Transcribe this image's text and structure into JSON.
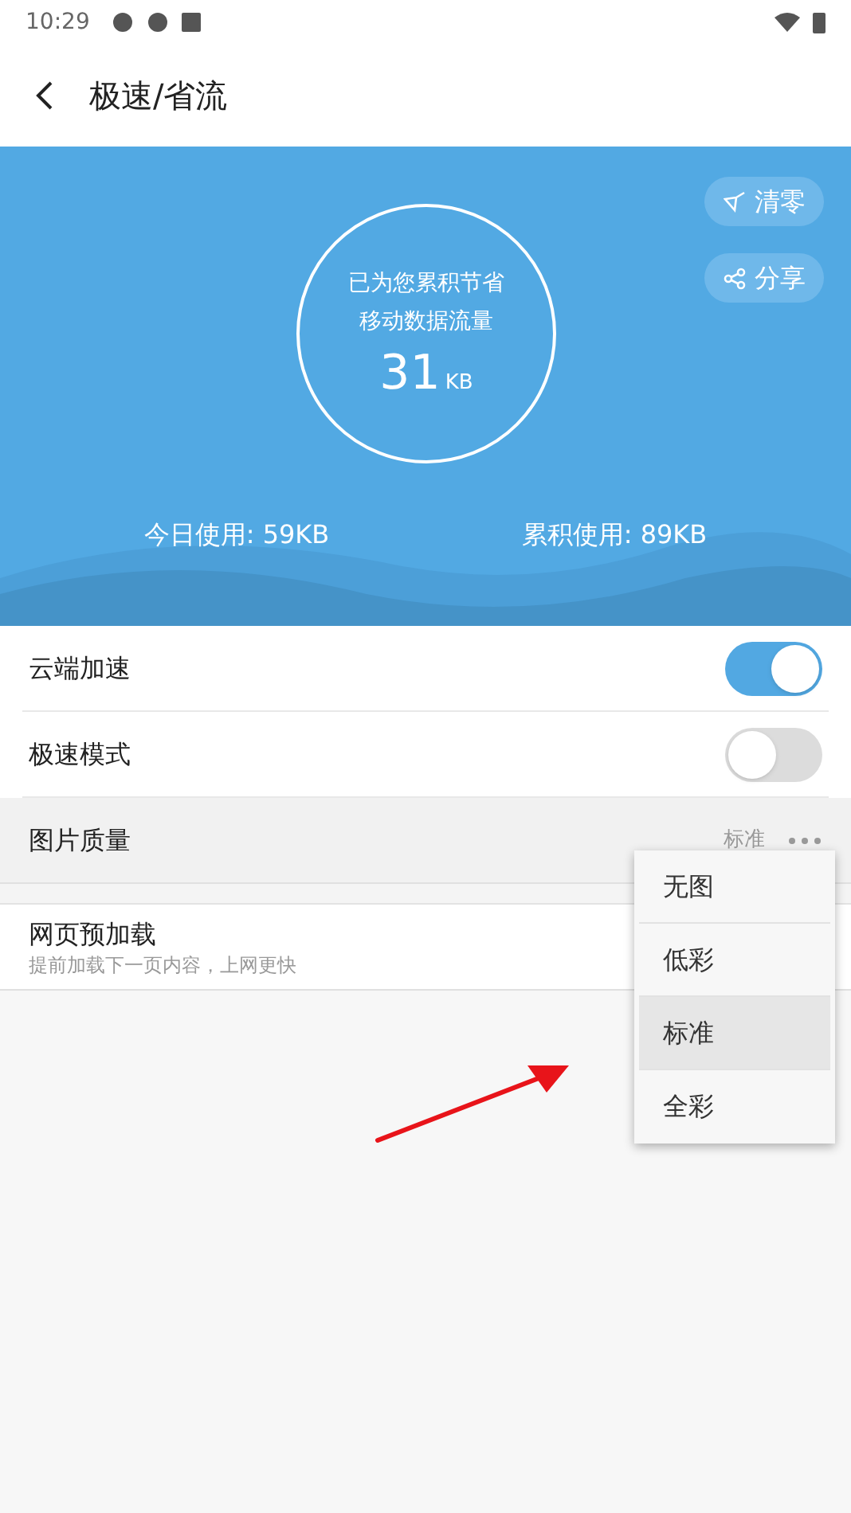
{
  "status_bar": {
    "time": "10:29"
  },
  "header": {
    "title": "极速/省流"
  },
  "banner": {
    "buttons": [
      {
        "kind": "clear",
        "label": "清零"
      },
      {
        "kind": "share",
        "label": "分享"
      }
    ],
    "circle": {
      "line1": "已为您累积节省",
      "line2": "移动数据流量",
      "value": "31",
      "unit": "KB"
    },
    "stats": [
      "今日使用: 59KB",
      "累积使用: 89KB"
    ]
  },
  "settings": [
    {
      "kind": "switch",
      "label": "云端加速",
      "on": true
    },
    {
      "kind": "switch",
      "label": "极速模式",
      "on": false
    },
    {
      "kind": "choice",
      "label": "图片质量",
      "value": "标准",
      "selected": true
    },
    {
      "kind": "spacer"
    },
    {
      "kind": "plain",
      "label": "网页预加载",
      "hint": "提前加载下一页内容，上网更快"
    }
  ],
  "menu": [
    {
      "label": "无图",
      "selected": false
    },
    {
      "label": "低彩",
      "selected": false
    },
    {
      "label": "标准",
      "selected": true
    },
    {
      "label": "全彩",
      "selected": false
    }
  ]
}
